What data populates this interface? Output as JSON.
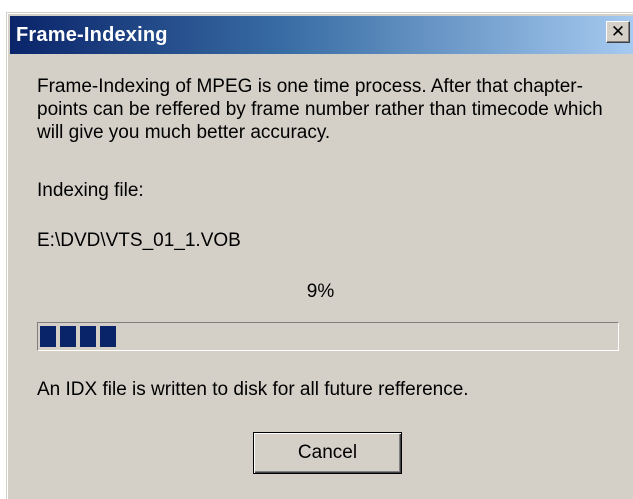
{
  "window": {
    "title": "Frame-Indexing",
    "close_glyph": "✕",
    "close_icon": "close-icon"
  },
  "content": {
    "description": "Frame-Indexing of MPEG is one time process. After that chapter-points can be reffered by frame number rather than timecode which will give you much better accuracy.",
    "indexing_label": "Indexing file:",
    "file_path": "E:\\DVD\\VTS_01_1.VOB",
    "percent_text": "9%",
    "progress_fraction": 0.09,
    "note": "An IDX file is written to disk for all future refference."
  },
  "buttons": {
    "cancel_label": "Cancel"
  },
  "colors": {
    "title_gradient_start": "#0a246a",
    "title_gradient_end": "#a6caf0",
    "progress_block": "#0a246a",
    "dialog_face": "#d4d0c8"
  }
}
